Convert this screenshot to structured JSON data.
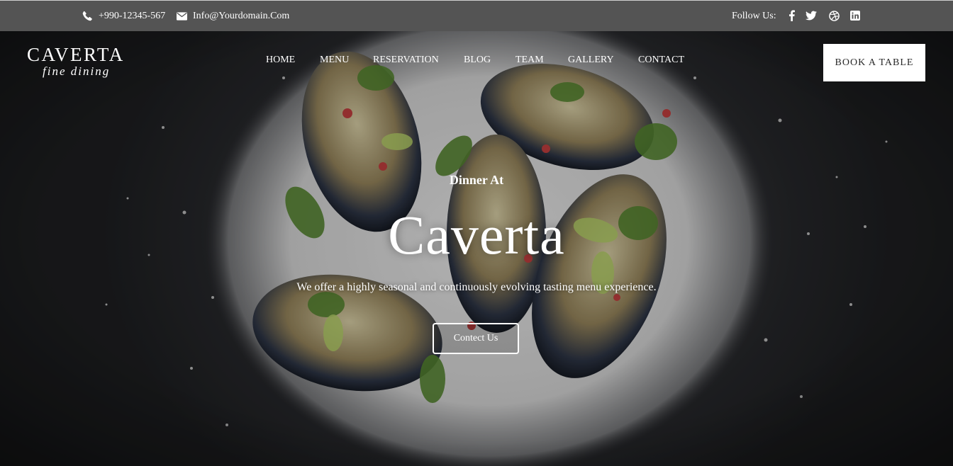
{
  "topbar": {
    "phone": "+990-12345-567",
    "email": "Info@Yourdomain.Com",
    "follow_label": "Follow Us:",
    "social_icons": [
      "facebook-icon",
      "twitter-icon",
      "dribbble-icon",
      "linkedin-icon"
    ]
  },
  "logo": {
    "main": "CAVERTA",
    "sub": "fine dining"
  },
  "nav": {
    "items": [
      {
        "label": "HOME"
      },
      {
        "label": "MENU"
      },
      {
        "label": "RESERVATION"
      },
      {
        "label": "BLOG"
      },
      {
        "label": "TEAM"
      },
      {
        "label": "GALLERY"
      },
      {
        "label": "CONTACT"
      }
    ],
    "cta": "BOOK A TABLE"
  },
  "hero": {
    "kicker": "Dinner At",
    "title": "Caverta",
    "description": "We offer a highly seasonal and continuously evolving tasting menu experience.",
    "button": "Contect Us"
  },
  "colors": {
    "topbar_bg": "#545454",
    "cta_bg": "#ffffff",
    "cta_text": "#2a2a2a"
  }
}
